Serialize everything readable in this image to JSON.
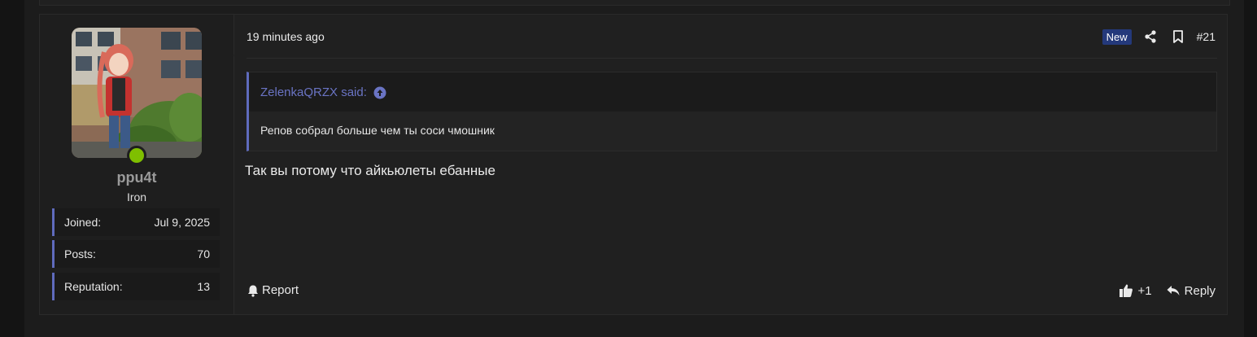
{
  "user": {
    "username": "ppu4t",
    "title": "Iron",
    "online": true,
    "stats": [
      {
        "label": "Joined:",
        "value": "Jul 9, 2025"
      },
      {
        "label": "Posts:",
        "value": "70"
      },
      {
        "label": "Reputation:",
        "value": "13"
      }
    ]
  },
  "post": {
    "time": "19 minutes ago",
    "badge": "New",
    "number": "#21",
    "quote": {
      "author_line": "ZelenkaQRZX said:",
      "text": "Репов собрал больше чем ты соси чмошник"
    },
    "message": "Так вы потому что айкьюлеты ебанные"
  },
  "footer": {
    "report_label": "Report",
    "like_count": "+1",
    "reply_label": "Reply"
  },
  "colors": {
    "accent": "#5f6bbd",
    "badge_bg": "#24397b",
    "online": "#7fbf00",
    "background": "#202020"
  },
  "icons": {
    "share": "share-icon",
    "bookmark": "bookmark-icon",
    "quote_jump": "arrow-up-circle-icon",
    "report": "bell-icon",
    "like": "thumbs-up-icon",
    "reply": "reply-icon"
  }
}
